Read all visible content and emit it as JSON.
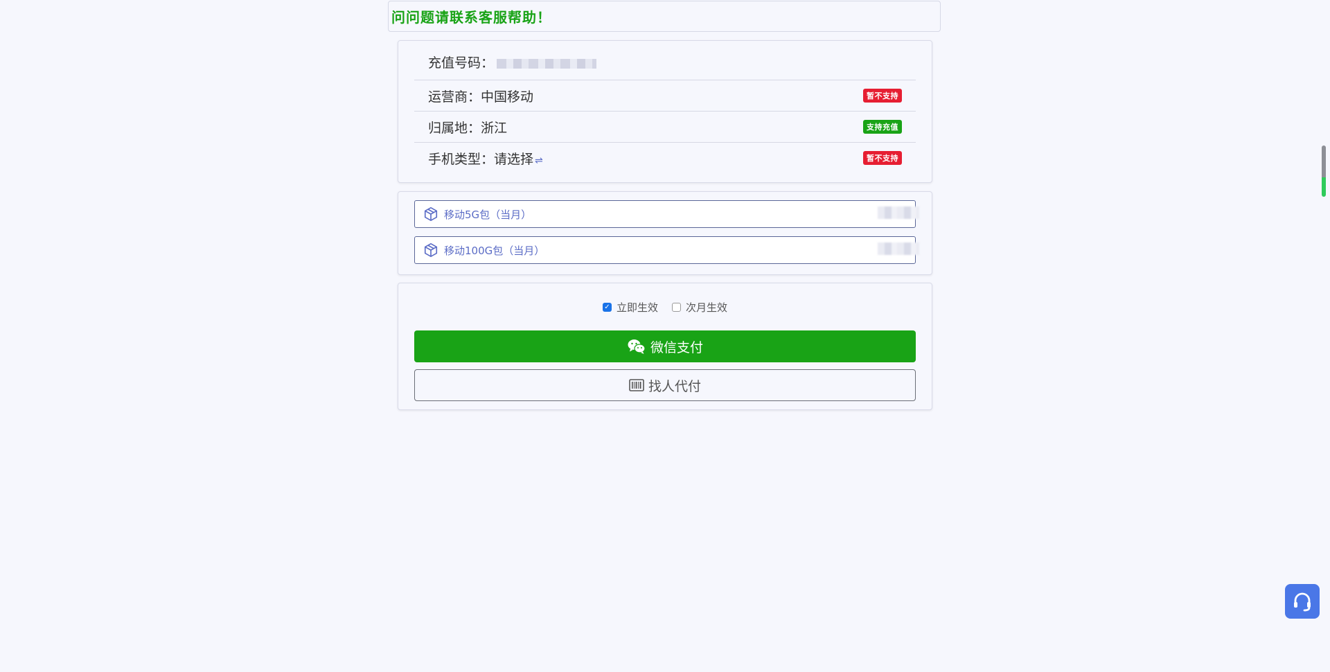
{
  "notice": {
    "text": "问问题请联系客服帮助！"
  },
  "info": {
    "phone_label": "充值号码：",
    "carrier_label": "运营商：",
    "carrier_value": "中国移动",
    "carrier_badge": "暂不支持",
    "region_label": "归属地：",
    "region_value": "浙江",
    "region_badge": "支持充值",
    "phone_type_label": "手机类型：",
    "phone_type_value": "请选择",
    "phone_type_swap": "⇌",
    "phone_type_badge": "暂不支持"
  },
  "packages": [
    {
      "name": "移动5G包（当月）"
    },
    {
      "name": "移动100G包（当月）"
    }
  ],
  "effect": {
    "immediate_label": "立即生效",
    "next_month_label": "次月生效",
    "selected": "immediate"
  },
  "actions": {
    "wechat_pay_label": "微信支付",
    "proxy_pay_label": "找人代付"
  },
  "colors": {
    "accent_green": "#19a316",
    "badge_red": "#e61e32",
    "link_blue": "#5b6cc6",
    "support_blue": "#4a77e7"
  },
  "icons": {
    "package": "box-icon",
    "wechat": "wechat-icon",
    "proxy": "barcode-icon",
    "support": "headset-icon"
  }
}
